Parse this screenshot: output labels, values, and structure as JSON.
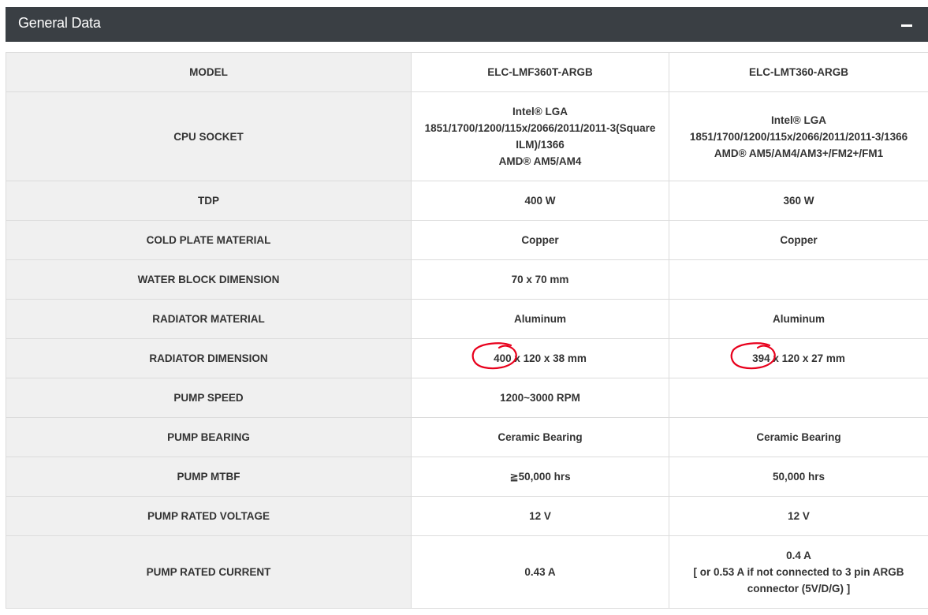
{
  "panel": {
    "title": "General Data",
    "collapse_icon": "minus-icon"
  },
  "table": {
    "columns": [
      "MODEL",
      "ELC-LMF360T-ARGB",
      "ELC-LMT360-ARGB"
    ],
    "rows": [
      {
        "label": "CPU SOCKET",
        "v1": [
          "Intel® LGA",
          "1851/1700/1200/115x/2066/2011/2011-3(Square",
          "ILM)/1366",
          "AMD® AM5/AM4"
        ],
        "v2": [
          "Intel® LGA",
          "1851/1700/1200/115x/2066/2011/2011-3/1366",
          "AMD® AM5/AM4/AM3+/FM2+/FM1"
        ]
      },
      {
        "label": "TDP",
        "v1": [
          "400 W"
        ],
        "v2": [
          "360 W"
        ]
      },
      {
        "label": "COLD PLATE MATERIAL",
        "v1": [
          "Copper"
        ],
        "v2": [
          "Copper"
        ]
      },
      {
        "label": "WATER BLOCK DIMENSION",
        "v1": [
          "70 x 70 mm"
        ],
        "v2": []
      },
      {
        "label": "RADIATOR MATERIAL",
        "v1": [
          "Aluminum"
        ],
        "v2": [
          "Aluminum"
        ]
      },
      {
        "label": "RADIATOR DIMENSION",
        "v1": [
          "400 x 120 x 38 mm"
        ],
        "v2": [
          "394 x 120 x 27 mm"
        ]
      },
      {
        "label": "PUMP SPEED",
        "v1": [
          "1200~3000 RPM"
        ],
        "v2": []
      },
      {
        "label": "PUMP BEARING",
        "v1": [
          "Ceramic Bearing"
        ],
        "v2": [
          "Ceramic Bearing"
        ]
      },
      {
        "label": "PUMP MTBF",
        "v1": [
          "≧50,000 hrs"
        ],
        "v2": [
          "50,000 hrs"
        ]
      },
      {
        "label": "PUMP RATED VOLTAGE",
        "v1": [
          "12 V"
        ],
        "v2": [
          "12 V"
        ]
      },
      {
        "label": "PUMP RATED CURRENT",
        "v1": [
          "0.43 A"
        ],
        "v2": [
          "0.4 A",
          "[ or 0.53 A if not connected to 3 pin ARGB",
          "connector (5V/D/G) ]"
        ]
      }
    ]
  },
  "annotations": {
    "color": "#e8001c",
    "circled_values": [
      "400",
      "394"
    ]
  },
  "colors": {
    "header_bg": "#3a3f44",
    "label_bg": "#f0f0f0",
    "border": "#dcdcdc",
    "text": "#333333"
  }
}
